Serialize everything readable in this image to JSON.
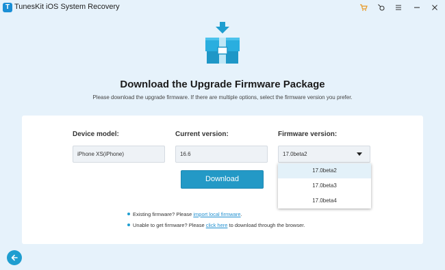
{
  "app": {
    "title": "TunesKit iOS System Recovery",
    "logo_letter": "T",
    "accent_color": "#1f9ed0"
  },
  "titlebar_icons": [
    "cart-icon",
    "account-icon",
    "menu-icon",
    "minimize-icon",
    "close-icon"
  ],
  "header": {
    "title": "Download the Upgrade Firmware Package",
    "subtitle": "Please download the upgrade firmware. If there are multiple options, select the firmware version you prefer."
  },
  "form": {
    "device_model_label": "Device model:",
    "device_model_value": "iPhone XS(iPhone)",
    "current_version_label": "Current version:",
    "current_version_value": "16.6",
    "firmware_version_label": "Firmware version:",
    "firmware_selected": "17.0beta2",
    "firmware_options": [
      "17.0beta2",
      "17.0beta3",
      "17.0beta4"
    ]
  },
  "download_button": "Download",
  "notes": {
    "existing_prefix": "Existing firmware? Please ",
    "existing_link": "import local firmware",
    "existing_suffix": ".",
    "unable_prefix": "Unable to get firmware? Please ",
    "unable_link": "click here",
    "unable_suffix": " to download through the browser."
  }
}
